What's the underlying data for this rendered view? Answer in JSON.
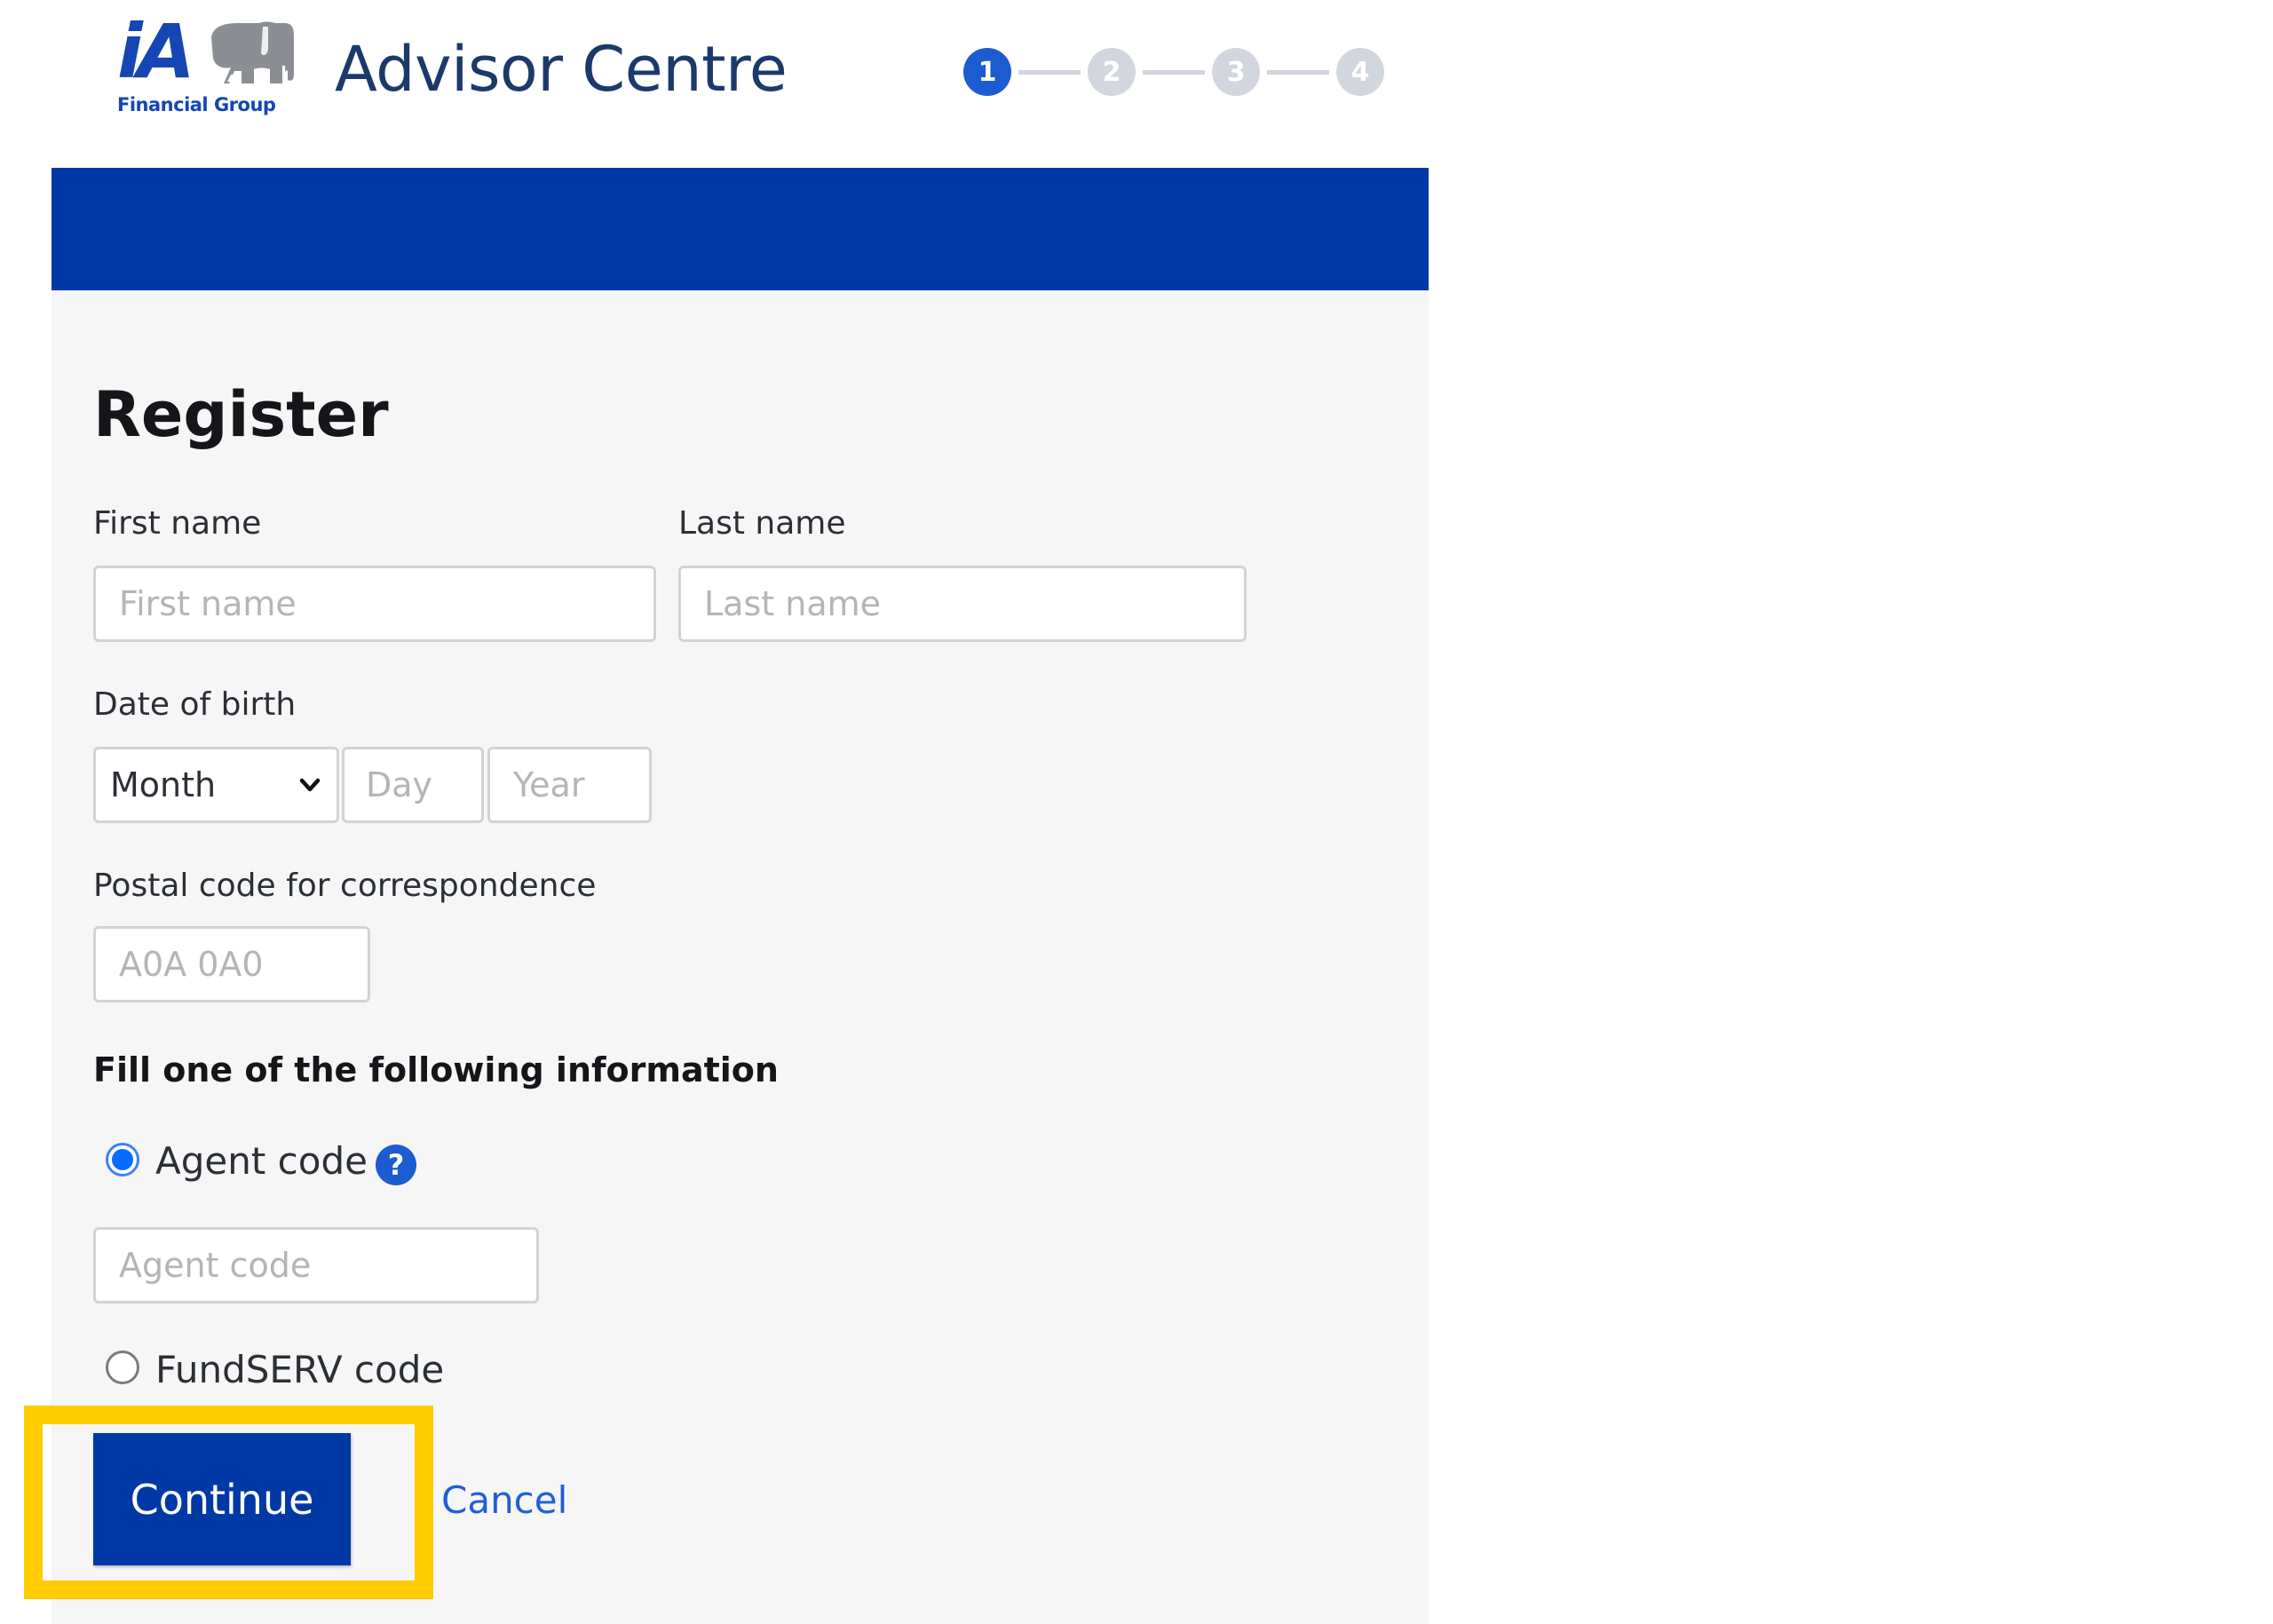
{
  "header": {
    "logo": {
      "mark": "iA",
      "subtitle": "Financial Group",
      "icon": "elephant-logo-icon"
    },
    "app_title": "Advisor Centre",
    "stepper": {
      "current_step": 1,
      "total_steps": 4,
      "steps": [
        "1",
        "2",
        "3",
        "4"
      ]
    }
  },
  "colors": {
    "brand_blue": "#0039a6",
    "accent_blue": "#1c5bd0",
    "link_blue": "#1f5fd6",
    "panel_bg": "#f6f6f6",
    "step_inactive": "#d2d6de",
    "highlight_yellow": "#ffcc00"
  },
  "form": {
    "title": "Register",
    "first_name": {
      "label": "First name",
      "placeholder": "First name",
      "value": ""
    },
    "last_name": {
      "label": "Last name",
      "placeholder": "Last name",
      "value": ""
    },
    "date_of_birth": {
      "label": "Date of birth",
      "month": {
        "selected": "Month"
      },
      "day": {
        "placeholder": "Day",
        "value": ""
      },
      "year": {
        "placeholder": "Year",
        "value": ""
      }
    },
    "postal_code": {
      "label": "Postal code for correspondence",
      "placeholder": "A0A 0A0",
      "value": ""
    },
    "identifier_section": {
      "title": "Fill one of the following information",
      "options": [
        {
          "label": "Agent code",
          "checked": true,
          "has_help": true
        },
        {
          "label": "FundSERV code",
          "checked": false,
          "has_help": false
        }
      ],
      "agent_code": {
        "placeholder": "Agent code",
        "value": ""
      }
    },
    "actions": {
      "continue_label": "Continue",
      "cancel_label": "Cancel"
    },
    "help_icon_glyph": "?"
  }
}
